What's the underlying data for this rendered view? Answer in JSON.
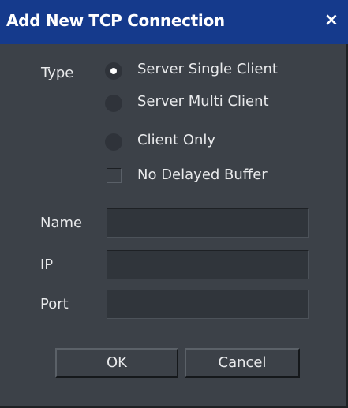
{
  "window": {
    "title": "Add New TCP Connection",
    "close_glyph": "×"
  },
  "type_section": {
    "label": "Type",
    "options": [
      {
        "label": "Server Single Client",
        "selected": true
      },
      {
        "label": "Server Multi Client",
        "selected": false
      },
      {
        "label": "Client Only",
        "selected": false
      }
    ],
    "checkbox": {
      "label": "No Delayed Buffer",
      "checked": false
    }
  },
  "fields": {
    "name": {
      "label": "Name",
      "value": ""
    },
    "ip": {
      "label": "IP",
      "value": ""
    },
    "port": {
      "label": "Port",
      "value": ""
    }
  },
  "buttons": {
    "ok": "OK",
    "cancel": "Cancel"
  },
  "colors": {
    "titlebar": "#153a8c",
    "panel": "#3c4148",
    "input_bg": "#30353b",
    "text": "#e9eaec"
  }
}
